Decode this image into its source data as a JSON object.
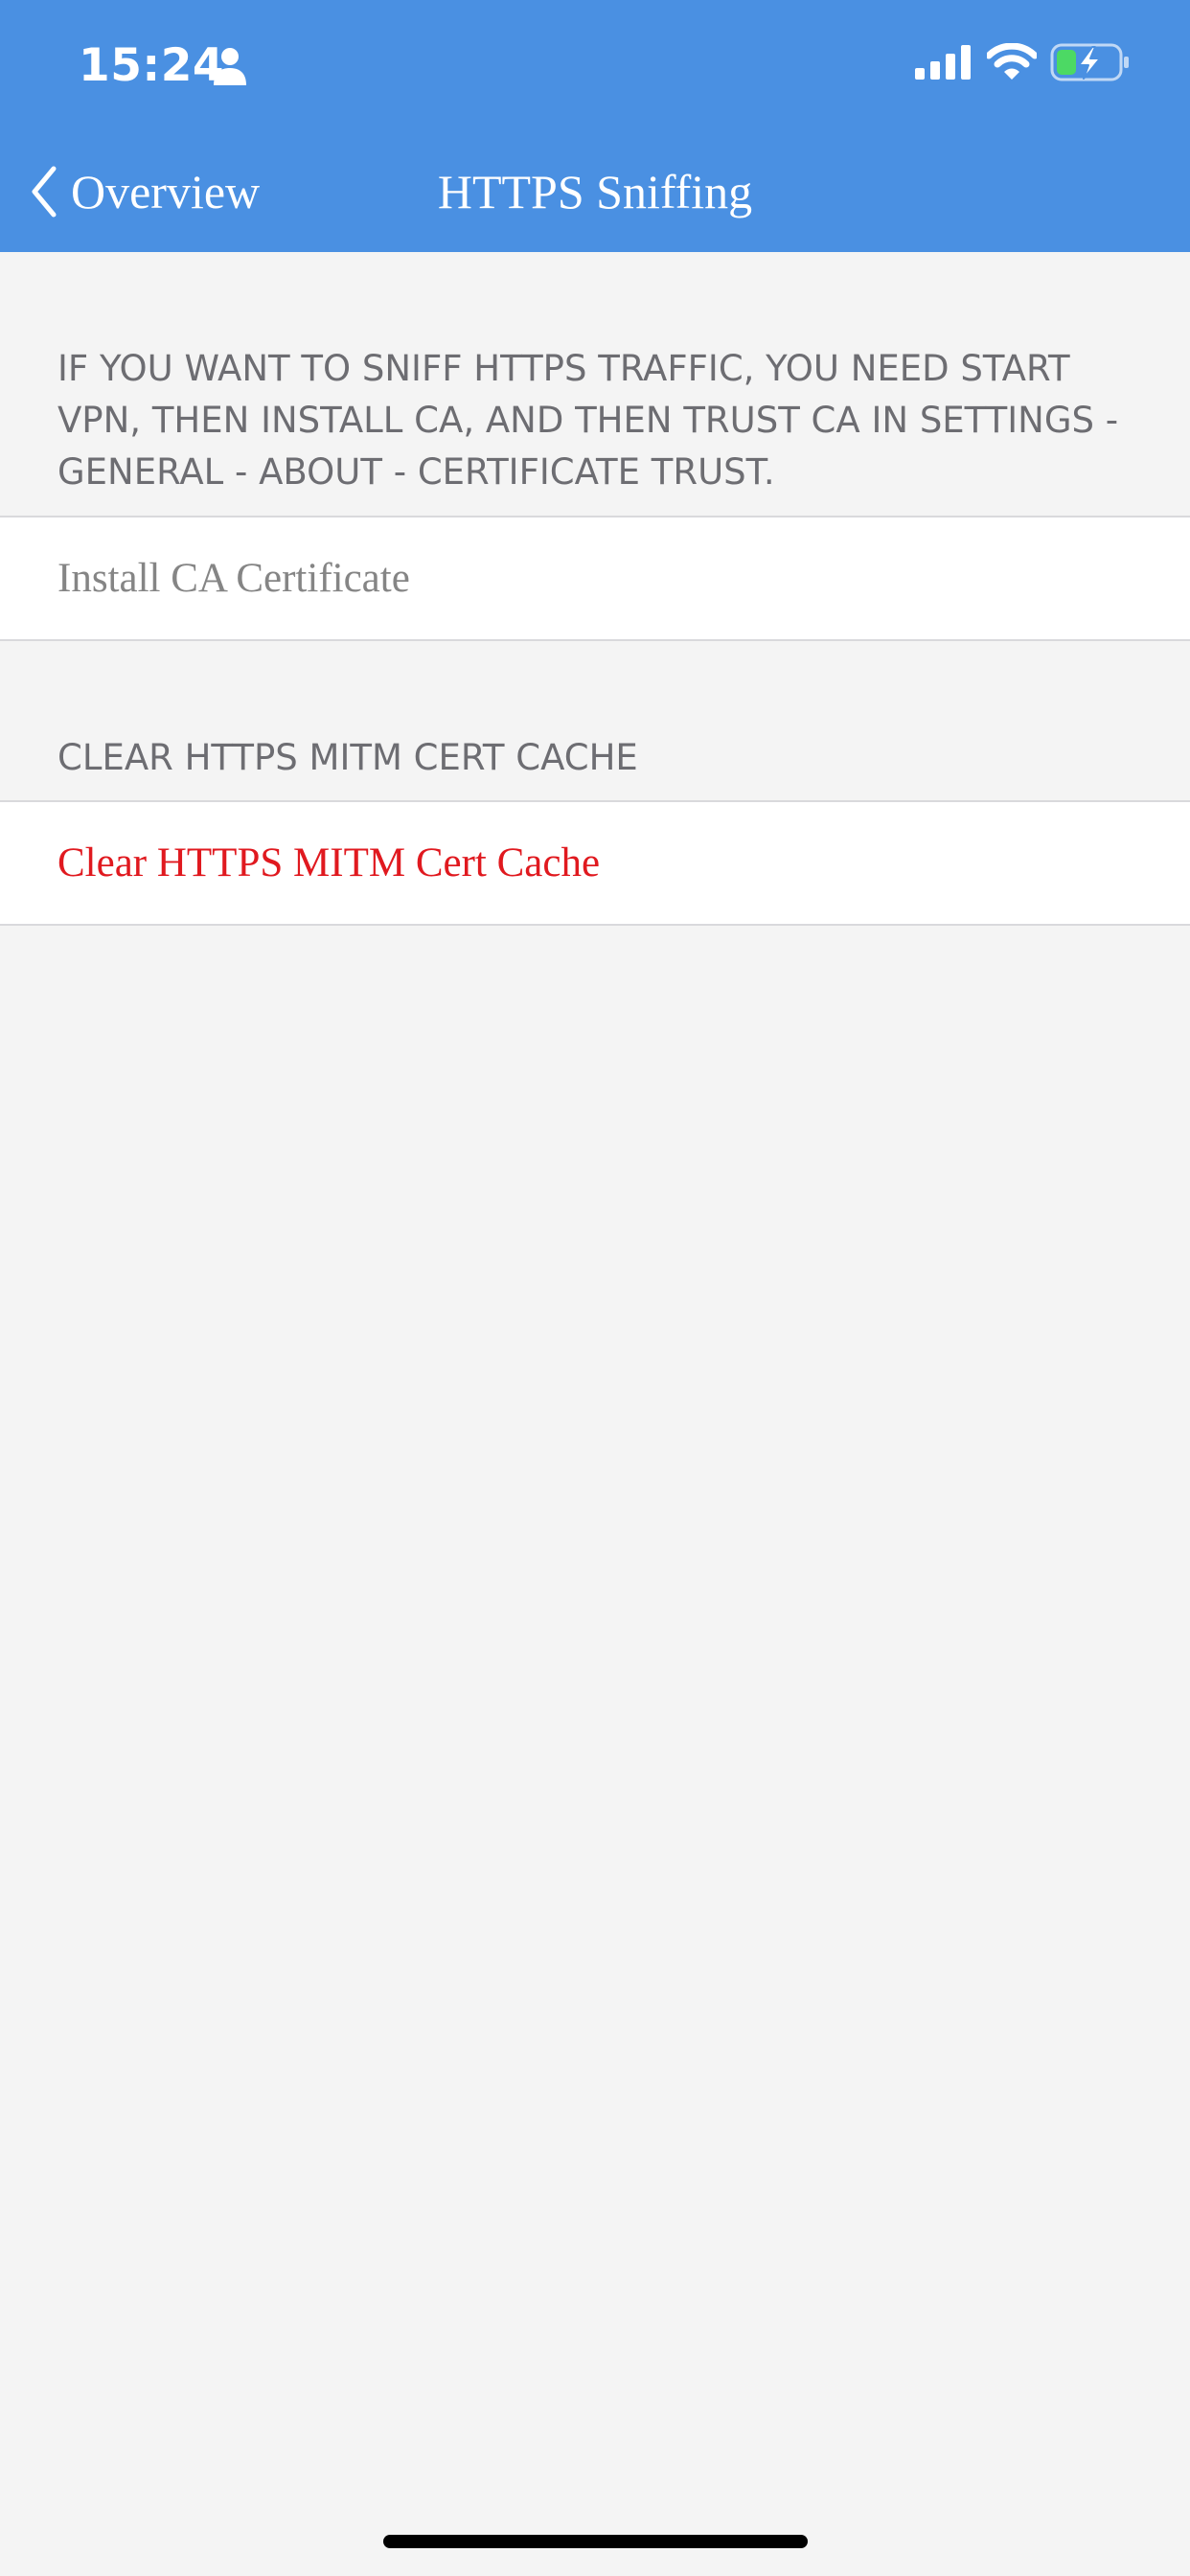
{
  "status_bar": {
    "time": "15:24",
    "icons": [
      "person-icon",
      "signal-icon",
      "wifi-icon",
      "battery-charging-icon"
    ],
    "battery_color": "#4cd964"
  },
  "nav": {
    "back_label": "Overview",
    "title": "HTTPS Sniffing",
    "bar_color": "#4a90e2"
  },
  "sections": [
    {
      "header": "IF YOU WANT TO SNIFF HTTPS TRAFFIC, YOU NEED START VPN, THEN INSTALL CA, AND THEN TRUST CA IN SETTINGS - GENERAL - ABOUT - CERTIFICATE TRUST.",
      "row_label": "Install CA Certificate",
      "row_color": "#858585"
    },
    {
      "header": "CLEAR HTTPS MITM CERT CACHE",
      "row_label": "Clear HTTPS MITM Cert Cache",
      "row_color": "#e0191f"
    }
  ]
}
